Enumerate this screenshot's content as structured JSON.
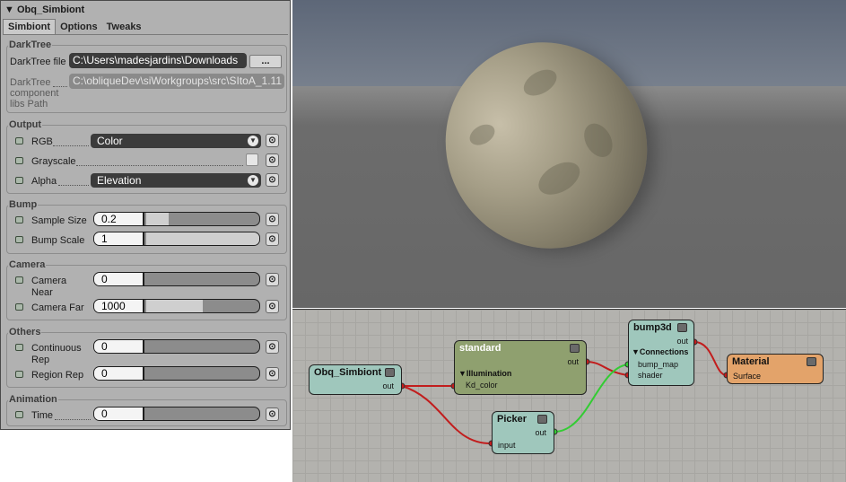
{
  "panel": {
    "title": "Obq_Simbiont",
    "tabs": [
      "Simbiont",
      "Options",
      "Tweaks"
    ],
    "darktree": {
      "group": "DarkTree",
      "file_label": "DarkTree file",
      "file_value": "C:\\Users\\madesjardins\\Downloads",
      "browse_label": "...",
      "libs_label_1": "DarkTree",
      "libs_label_2": "component",
      "libs_label_3": "libs Path",
      "libs_value": "C:\\obliqueDev\\siWorkgroups\\src\\SItoA_1.11"
    },
    "output": {
      "group": "Output",
      "rgb_label": "RGB",
      "rgb_value": "Color",
      "gray_label": "Grayscale",
      "gray_checked": false,
      "alpha_label": "Alpha",
      "alpha_value": "Elevation"
    },
    "bump": {
      "group": "Bump",
      "size_label": "Sample Size",
      "size_value": "0.2",
      "size_fraction": 0.2,
      "scale_label": "Bump Scale",
      "scale_value": "1",
      "scale_fraction": 1.0
    },
    "camera": {
      "group": "Camera",
      "near_label_1": "Camera",
      "near_label_2": "Near",
      "near_value": "0",
      "near_fraction": 0.0,
      "far_label": "Camera Far",
      "far_value": "1000",
      "far_fraction": 0.5
    },
    "others": {
      "group": "Others",
      "cont_label_1": "Continuous",
      "cont_label_2": "Rep",
      "cont_value": "0",
      "region_label": "Region Rep",
      "region_value": "0"
    },
    "animation": {
      "group": "Animation",
      "time_label": "Time",
      "time_value": "0"
    }
  },
  "render_tree": {
    "nodes": {
      "simbiont": {
        "title": "Obq_Simbiont",
        "out": "out",
        "color": "#9fc7bc"
      },
      "standard": {
        "title": "standard",
        "out": "out",
        "section": "Illumination",
        "port": "Kd_color",
        "color": "#8fa06f"
      },
      "picker": {
        "title": "Picker",
        "out": "out",
        "port": "input",
        "color": "#9fc7bc"
      },
      "bump3d": {
        "title": "bump3d",
        "out": "out",
        "section": "Connections",
        "port1": "bump_map",
        "port2": "shader",
        "color": "#9fc7bc"
      },
      "material": {
        "title": "Material",
        "port": "Surface",
        "color": "#e3a36a"
      }
    },
    "wire_red": "#c21d1d",
    "wire_green": "#33cc33"
  }
}
